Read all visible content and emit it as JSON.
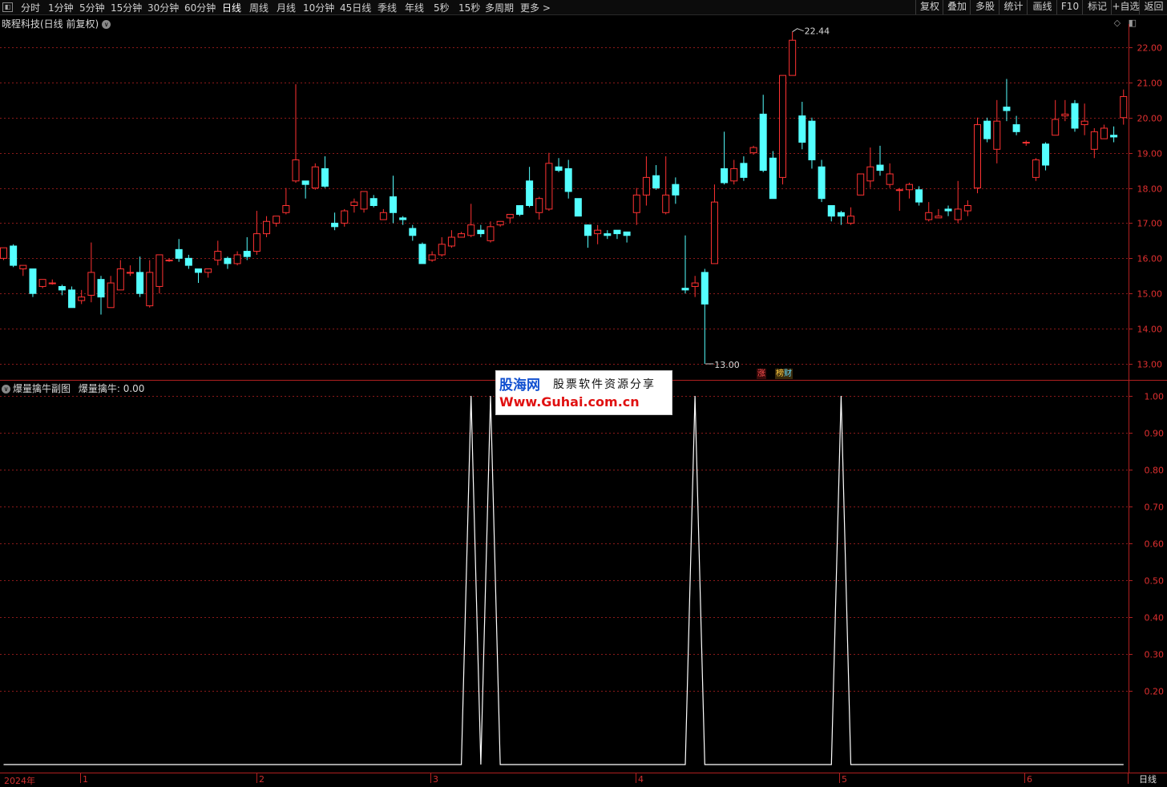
{
  "toolbar": {
    "left_items": [
      "分时",
      "1分钟",
      "5分钟",
      "15分钟",
      "30分钟",
      "60分钟",
      "日线",
      "周线",
      "月线",
      "10分钟",
      "45日线",
      "季线",
      "年线",
      "5秒",
      "15秒",
      "多周期",
      "更多 >"
    ],
    "active_index": 6,
    "right_items": [
      "复权",
      "叠加",
      "多股",
      "统计",
      "画线",
      "F10",
      "标记",
      "+自选",
      "返回"
    ]
  },
  "main_chart": {
    "title": "晓程科技(日线 前复权)",
    "y_ticks": [
      "22.00",
      "21.00",
      "20.00",
      "19.00",
      "18.00",
      "17.00",
      "16.00",
      "15.00",
      "14.00",
      "13.00"
    ],
    "high_label": "22.44",
    "low_label": "13.00",
    "tag_up": "涨",
    "tag_bang": "榜",
    "tag_cai": "财",
    "colors": {
      "up": "#ff3232",
      "down": "#54ffff",
      "grid": "#8b1a1a"
    }
  },
  "sub_chart": {
    "title": "爆量擒牛副图",
    "indicator_label": "爆量擒牛:",
    "indicator_value": "0.00",
    "y_ticks": [
      "1.00",
      "0.90",
      "0.80",
      "0.70",
      "0.60",
      "0.50",
      "0.40",
      "0.30",
      "0.20"
    ]
  },
  "dates": {
    "labels": [
      "2024年",
      "1",
      "2",
      "3",
      "4",
      "5",
      "6"
    ],
    "period_tab": "日线"
  },
  "watermark": {
    "cn_site": "股海网",
    "slogan": "股票软件资源分享",
    "url": "Www.Guhai.com.cn"
  },
  "chart_data": {
    "type": "candlestick",
    "ylim": [
      12.85,
      22.6
    ],
    "candles": [
      [
        16.0,
        16.3,
        15.95,
        16.2
      ],
      [
        16.35,
        15.8,
        15.75,
        16.4
      ],
      [
        15.7,
        15.8,
        15.5,
        15.7
      ],
      [
        15.7,
        15.0,
        14.9,
        15.7
      ],
      [
        15.2,
        15.4,
        15.15,
        15.4
      ],
      [
        15.3,
        15.3,
        15.25,
        15.4
      ],
      [
        15.2,
        15.1,
        14.95,
        15.25
      ],
      [
        15.1,
        14.6,
        14.6,
        15.2
      ],
      [
        14.8,
        14.9,
        14.7,
        15.1
      ],
      [
        14.95,
        15.6,
        14.75,
        16.45
      ],
      [
        15.4,
        14.9,
        14.4,
        15.5
      ],
      [
        14.6,
        15.3,
        14.6,
        15.5
      ],
      [
        15.1,
        15.7,
        15.1,
        15.95
      ],
      [
        15.6,
        15.6,
        15.5,
        15.8
      ],
      [
        15.6,
        15.0,
        14.9,
        16.05
      ],
      [
        14.65,
        15.6,
        14.6,
        15.95
      ],
      [
        15.2,
        16.1,
        15.0,
        16.1
      ],
      [
        15.95,
        15.95,
        15.9,
        16.0
      ],
      [
        16.25,
        16.0,
        15.9,
        16.55
      ],
      [
        16.0,
        15.8,
        15.7,
        16.1
      ],
      [
        15.7,
        15.6,
        15.3,
        15.7
      ],
      [
        15.6,
        15.7,
        15.45,
        15.7
      ],
      [
        15.95,
        16.2,
        15.8,
        16.5
      ],
      [
        16.0,
        15.85,
        15.7,
        16.05
      ],
      [
        15.85,
        16.1,
        15.8,
        16.2
      ],
      [
        16.2,
        16.05,
        15.95,
        16.6
      ],
      [
        16.2,
        16.7,
        16.1,
        17.35
      ],
      [
        16.7,
        17.05,
        16.6,
        17.2
      ],
      [
        17.0,
        17.2,
        16.9,
        17.2
      ],
      [
        17.3,
        17.5,
        17.25,
        18.0
      ],
      [
        18.2,
        18.8,
        18.15,
        20.95
      ],
      [
        18.2,
        18.1,
        17.7,
        18.2
      ],
      [
        18.0,
        18.6,
        17.95,
        18.7
      ],
      [
        18.55,
        18.05,
        18.0,
        18.9
      ],
      [
        17.0,
        16.9,
        16.8,
        17.3
      ],
      [
        17.0,
        17.35,
        16.9,
        17.4
      ],
      [
        17.5,
        17.6,
        17.3,
        17.7
      ],
      [
        17.4,
        17.9,
        17.3,
        17.9
      ],
      [
        17.7,
        17.5,
        17.45,
        17.8
      ],
      [
        17.1,
        17.3,
        17.1,
        17.4
      ],
      [
        17.75,
        17.3,
        17.0,
        18.35
      ],
      [
        17.15,
        17.1,
        16.95,
        17.2
      ],
      [
        16.85,
        16.65,
        16.5,
        16.95
      ],
      [
        16.4,
        15.85,
        15.85,
        16.45
      ],
      [
        15.95,
        16.1,
        15.9,
        16.2
      ],
      [
        16.1,
        16.4,
        16.05,
        16.6
      ],
      [
        16.35,
        16.6,
        16.3,
        16.8
      ],
      [
        16.6,
        16.7,
        16.6,
        16.75
      ],
      [
        16.65,
        16.95,
        16.6,
        17.55
      ],
      [
        16.8,
        16.7,
        16.6,
        16.95
      ],
      [
        16.5,
        16.9,
        16.45,
        17.05
      ],
      [
        16.95,
        17.05,
        16.9,
        17.0
      ],
      [
        17.15,
        17.25,
        17.0,
        17.25
      ],
      [
        17.5,
        17.25,
        17.2,
        17.5
      ],
      [
        18.2,
        17.5,
        17.45,
        18.6
      ],
      [
        17.3,
        17.7,
        17.1,
        17.75
      ],
      [
        17.4,
        18.7,
        17.35,
        19.0
      ],
      [
        18.6,
        18.5,
        18.45,
        18.85
      ],
      [
        18.55,
        17.9,
        17.7,
        18.8
      ],
      [
        17.7,
        17.2,
        17.2,
        17.7
      ],
      [
        16.95,
        16.65,
        16.3,
        16.95
      ],
      [
        16.7,
        16.8,
        16.4,
        16.95
      ],
      [
        16.7,
        16.65,
        16.55,
        16.8
      ],
      [
        16.8,
        16.7,
        16.55,
        16.8
      ],
      [
        16.75,
        16.65,
        16.45,
        16.75
      ],
      [
        17.3,
        17.8,
        16.95,
        18.0
      ],
      [
        17.8,
        18.3,
        17.5,
        18.9
      ],
      [
        18.35,
        18.0,
        17.95,
        18.65
      ],
      [
        17.3,
        17.8,
        17.25,
        18.9
      ],
      [
        18.1,
        17.8,
        17.55,
        18.3
      ],
      [
        15.15,
        15.1,
        15.0,
        16.65
      ],
      [
        15.2,
        15.3,
        14.9,
        15.5
      ],
      [
        15.6,
        14.7,
        13.0,
        15.7
      ],
      [
        15.85,
        17.6,
        15.85,
        18.1
      ],
      [
        18.55,
        18.15,
        18.1,
        19.6
      ],
      [
        18.2,
        18.55,
        18.1,
        18.8
      ],
      [
        18.7,
        18.3,
        18.2,
        18.9
      ],
      [
        19.0,
        19.15,
        18.95,
        19.2
      ],
      [
        20.1,
        18.5,
        18.45,
        20.65
      ],
      [
        18.85,
        17.7,
        17.7,
        19.05
      ],
      [
        18.3,
        21.2,
        18.1,
        21.2
      ],
      [
        21.2,
        22.2,
        21.2,
        22.44
      ],
      [
        20.05,
        19.3,
        19.1,
        20.45
      ],
      [
        19.9,
        18.8,
        18.55,
        20.0
      ],
      [
        18.6,
        17.7,
        17.6,
        18.8
      ],
      [
        17.5,
        17.2,
        17.05,
        17.5
      ],
      [
        17.3,
        17.2,
        16.95,
        17.35
      ],
      [
        17.0,
        17.2,
        16.95,
        17.45
      ],
      [
        17.8,
        18.4,
        17.85,
        18.3
      ],
      [
        18.2,
        18.6,
        18.0,
        19.15
      ],
      [
        18.65,
        18.5,
        18.35,
        19.2
      ],
      [
        18.1,
        18.4,
        18.0,
        18.7
      ],
      [
        17.95,
        17.95,
        17.35,
        18.0
      ],
      [
        17.95,
        18.1,
        17.7,
        18.15
      ],
      [
        17.95,
        17.6,
        17.5,
        18.05
      ],
      [
        17.1,
        17.3,
        17.05,
        17.6
      ],
      [
        17.15,
        17.2,
        17.15,
        17.4
      ],
      [
        17.4,
        17.35,
        17.2,
        17.5
      ],
      [
        17.1,
        17.4,
        17.0,
        18.2
      ],
      [
        17.35,
        17.5,
        17.2,
        17.65
      ],
      [
        18.0,
        19.8,
        17.85,
        20.0
      ],
      [
        19.9,
        19.4,
        19.3,
        20.0
      ],
      [
        19.1,
        19.9,
        18.7,
        20.5
      ],
      [
        20.3,
        20.2,
        19.9,
        21.1
      ],
      [
        19.8,
        19.6,
        19.5,
        20.05
      ],
      [
        19.3,
        19.3,
        19.2,
        19.35
      ],
      [
        18.3,
        18.8,
        18.2,
        18.85
      ],
      [
        19.25,
        18.65,
        18.5,
        19.3
      ],
      [
        19.5,
        19.95,
        19.5,
        20.5
      ],
      [
        20.05,
        20.1,
        19.9,
        20.5
      ],
      [
        20.4,
        19.7,
        19.6,
        20.5
      ],
      [
        19.8,
        19.9,
        19.5,
        20.4
      ],
      [
        19.1,
        19.6,
        18.85,
        19.7
      ],
      [
        19.4,
        19.7,
        19.4,
        19.8
      ],
      [
        19.5,
        19.45,
        19.3,
        19.75
      ],
      [
        20.0,
        20.6,
        19.8,
        20.8
      ]
    ],
    "indicator": {
      "name": "爆量擒牛",
      "ylim": [
        0,
        1.0
      ],
      "spikes": [
        48,
        50,
        71,
        86
      ]
    }
  }
}
